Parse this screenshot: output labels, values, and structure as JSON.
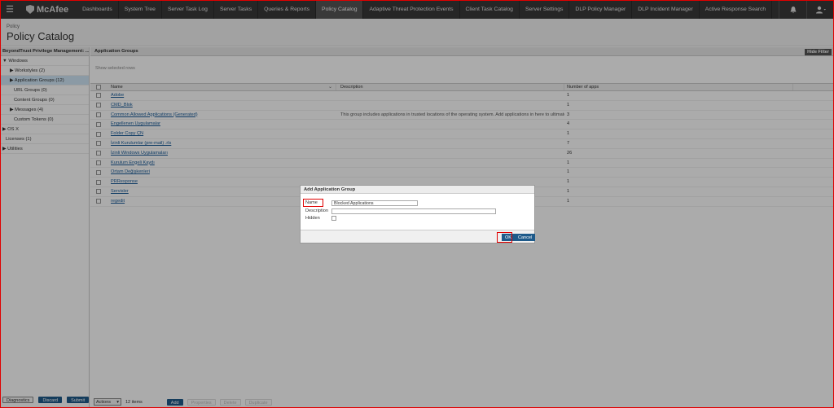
{
  "header": {
    "menu_icon": "hamburger-icon",
    "logo": "McAfee",
    "nav": [
      "Dashboards",
      "System Tree",
      "Server Task Log",
      "Server Tasks",
      "Queries & Reports",
      "Policy Catalog",
      "Adaptive Threat Protection Events",
      "Client Task Catalog",
      "Server Settings",
      "DLP Policy Manager",
      "DLP Incident Manager",
      "Active Response Search"
    ],
    "active_nav": "Policy Catalog",
    "icons": [
      "bell-icon",
      "user-icon"
    ]
  },
  "page": {
    "breadcrumb": "Policy",
    "title": "Policy Catalog"
  },
  "sidebar": {
    "header": "BeyondTrust Privilege Management: ...",
    "items": [
      {
        "label": "Windows",
        "arrow": "▼"
      },
      {
        "label": "Workstyles (2)",
        "arrow": "▶"
      },
      {
        "label": "Application Groups (12)",
        "arrow": "▶",
        "selected": true
      },
      {
        "label": "URL Groups (0)",
        "arrow": ""
      },
      {
        "label": "Content Groups (0)",
        "arrow": ""
      },
      {
        "label": "Messages (4)",
        "arrow": "▶"
      },
      {
        "label": "Custom Tokens (0)",
        "arrow": ""
      },
      {
        "label": "OS X",
        "arrow": "▶"
      },
      {
        "label": "Licenses (1)",
        "arrow": ""
      },
      {
        "label": "Utilities",
        "arrow": "▶"
      }
    ],
    "buttons": {
      "diagnostics": "Diagnostics",
      "discard": "Discard",
      "submit": "Submit"
    }
  },
  "main": {
    "header": "Application Groups",
    "hide_filter": "Hide Filter",
    "show_selected": "Show selected rows",
    "columns": {
      "name": "Name",
      "description": "Description",
      "count": "Number of apps"
    },
    "rows": [
      {
        "name": "Adobe",
        "description": "",
        "count": "1"
      },
      {
        "name": "CMD_Blok",
        "description": "",
        "count": "1"
      },
      {
        "name": "Common Allowed Applications (Generated)",
        "description": "This group includes applications in trusted locations of the operating system. Add applications in here to ultimately allow them to run",
        "count": "3"
      },
      {
        "name": "Engellenen Uygulamalar",
        "description": "",
        "count": "4"
      },
      {
        "name": "Folder Copy ÇN",
        "description": "",
        "count": "1"
      },
      {
        "name": "İzinli Kurulumlar (pre-mail) .rls",
        "description": "",
        "count": "7"
      },
      {
        "name": "İzinli Windows Uygulamaları",
        "description": "",
        "count": "26"
      },
      {
        "name": "Kurulum Engeli Kaydı",
        "description": "",
        "count": "1"
      },
      {
        "name": "Ortam Değişkenleri",
        "description": "",
        "count": "1"
      },
      {
        "name": "PRResponse",
        "description": "",
        "count": "1"
      },
      {
        "name": "Servisler",
        "description": "",
        "count": "1"
      },
      {
        "name": "regedit",
        "description": "",
        "count": "1"
      }
    ],
    "bottom": {
      "actions": "Actions",
      "items_count": "12 items",
      "add": "Add",
      "properties": "Properties",
      "delete": "Delete",
      "duplicate": "Duplicate"
    }
  },
  "dialog": {
    "title": "Add Application Group",
    "name_label": "Name",
    "name_value": "Blocked Applications",
    "description_label": "Description",
    "description_value": "",
    "hidden_label": "Hidden",
    "ok": "OK",
    "cancel": "Cancel"
  },
  "colors": {
    "highlight": "#e00000",
    "header_bg": "#3a3a3a",
    "primary_button": "#1e5a8a"
  }
}
